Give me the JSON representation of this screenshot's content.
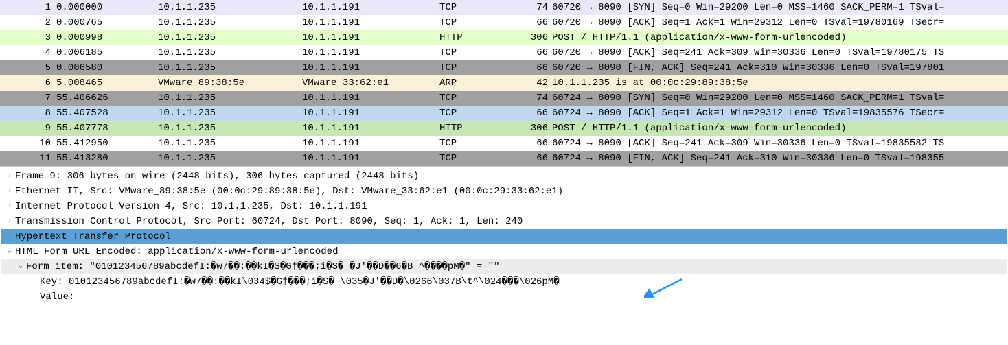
{
  "packets": [
    {
      "cls": "c-lilac",
      "no": "1",
      "time": "0.000000",
      "src": "10.1.1.235",
      "dst": "10.1.1.191",
      "proto": "TCP",
      "len": "74",
      "info": "60720 → 8090 [SYN] Seq=0 Win=29200 Len=0 MSS=1460 SACK_PERM=1 TSval="
    },
    {
      "cls": "c-white",
      "no": "2",
      "time": "0.000765",
      "src": "10.1.1.235",
      "dst": "10.1.1.191",
      "proto": "TCP",
      "len": "66",
      "info": "60720 → 8090 [ACK] Seq=1 Ack=1 Win=29312 Len=0 TSval=19780169 TSecr="
    },
    {
      "cls": "c-lime",
      "no": "3",
      "time": "0.000998",
      "src": "10.1.1.235",
      "dst": "10.1.1.191",
      "proto": "HTTP",
      "len": "306",
      "info": "POST / HTTP/1.1  (application/x-www-form-urlencoded)"
    },
    {
      "cls": "c-white",
      "no": "4",
      "time": "0.006185",
      "src": "10.1.1.235",
      "dst": "10.1.1.191",
      "proto": "TCP",
      "len": "66",
      "info": "60720 → 8090 [ACK] Seq=241 Ack=309 Win=30336 Len=0 TSval=19780175 TS"
    },
    {
      "cls": "c-gray",
      "no": "5",
      "time": "0.006580",
      "src": "10.1.1.235",
      "dst": "10.1.1.191",
      "proto": "TCP",
      "len": "66",
      "info": "60720 → 8090 [FIN, ACK] Seq=241 Ack=310 Win=30336 Len=0 TSval=197801"
    },
    {
      "cls": "c-cream",
      "no": "6",
      "time": "5.008465",
      "src": "VMware_89:38:5e",
      "dst": "VMware_33:62:e1",
      "proto": "ARP",
      "len": "42",
      "info": "10.1.1.235 is at 00:0c:29:89:38:5e"
    },
    {
      "cls": "c-gray",
      "no": "7",
      "time": "55.406626",
      "src": "10.1.1.235",
      "dst": "10.1.1.191",
      "proto": "TCP",
      "len": "74",
      "info": "60724 → 8090 [SYN] Seq=0 Win=29200 Len=0 MSS=1460 SACK_PERM=1 TSval="
    },
    {
      "cls": "c-blue",
      "no": "8",
      "time": "55.407528",
      "src": "10.1.1.235",
      "dst": "10.1.1.191",
      "proto": "TCP",
      "len": "66",
      "info": "60724 → 8090 [ACK] Seq=1 Ack=1 Win=29312 Len=0 TSval=19835576 TSecr="
    },
    {
      "cls": "c-green",
      "no": "9",
      "time": "55.407778",
      "src": "10.1.1.235",
      "dst": "10.1.1.191",
      "proto": "HTTP",
      "len": "306",
      "info": "POST / HTTP/1.1  (application/x-www-form-urlencoded)"
    },
    {
      "cls": "c-white",
      "no": "10",
      "time": "55.412950",
      "src": "10.1.1.235",
      "dst": "10.1.1.191",
      "proto": "TCP",
      "len": "66",
      "info": "60724 → 8090 [ACK] Seq=241 Ack=309 Win=30336 Len=0 TSval=19835582 TS"
    },
    {
      "cls": "c-gray",
      "no": "11",
      "time": "55.413280",
      "src": "10.1.1.235",
      "dst": "10.1.1.191",
      "proto": "TCP",
      "len": "66",
      "info": "60724 → 8090 [FIN, ACK] Seq=241 Ack=310 Win=30336 Len=0 TSval=198355"
    }
  ],
  "details": [
    {
      "lv": 0,
      "tw": "›",
      "hi": "",
      "label": "Frame 9: 306 bytes on wire (2448 bits), 306 bytes captured (2448 bits)"
    },
    {
      "lv": 0,
      "tw": "›",
      "hi": "",
      "label": "Ethernet II, Src: VMware_89:38:5e (00:0c:29:89:38:5e), Dst: VMware_33:62:e1 (00:0c:29:33:62:e1)"
    },
    {
      "lv": 0,
      "tw": "›",
      "hi": "",
      "label": "Internet Protocol Version 4, Src: 10.1.1.235, Dst: 10.1.1.191"
    },
    {
      "lv": 0,
      "tw": "›",
      "hi": "",
      "label": "Transmission Control Protocol, Src Port: 60724, Dst Port: 8090, Seq: 1, Ack: 1, Len: 240"
    },
    {
      "lv": 0,
      "tw": "›",
      "hi": "sel",
      "label": "Hypertext Transfer Protocol"
    },
    {
      "lv": 0,
      "tw": "⌄",
      "hi": "",
      "label": "HTML Form URL Encoded: application/x-www-form-urlencoded"
    },
    {
      "lv": 1,
      "tw": "⌄",
      "hi": "sub",
      "label": "Form item: \"010123456789abcdefI:�w7��:��kI�$�G†���;i�S�_�J'��D��6�B   ^����pM�\" = \"\""
    },
    {
      "lv": 2,
      "tw": "",
      "hi": "",
      "label": "Key: 010123456789abcdefI:�w7��:��kI\\034$�G†���;i�S�_\\035�J'��D�\\0266\\037B\\t^\\024���\\026pM�"
    },
    {
      "lv": 2,
      "tw": "",
      "hi": "",
      "label": "Value:"
    }
  ]
}
